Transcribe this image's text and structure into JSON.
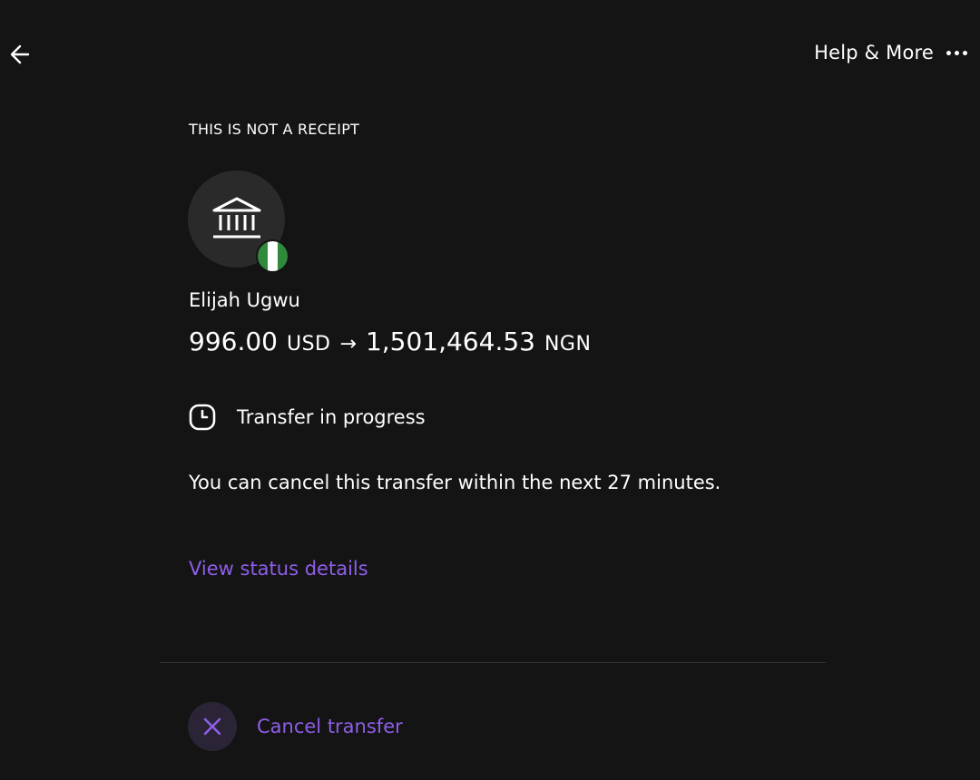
{
  "header": {
    "back_icon": "arrow-left-icon",
    "help_label": "Help & More",
    "more_icon": "more-horizontal-icon"
  },
  "notice": {
    "not_receipt": "THIS IS NOT A RECEIPT"
  },
  "recipient": {
    "avatar_icon": "bank-icon",
    "country_flag": "nigeria-flag",
    "name": "Elijah Ugwu"
  },
  "amount": {
    "send_value": "996.00",
    "send_currency": "USD",
    "arrow": "→",
    "receive_value": "1,501,464.53",
    "receive_currency": "NGN"
  },
  "status": {
    "icon": "clock-icon",
    "text": "Transfer in progress"
  },
  "cancel_notice": "You can cancel this transfer within the next 27 minutes.",
  "links": {
    "view_status": "View status details"
  },
  "actions": {
    "cancel_icon": "close-icon",
    "cancel_label": "Cancel transfer"
  },
  "colors": {
    "background": "#141414",
    "accent": "#8f5ee8",
    "flag_green": "#2f8a3c"
  }
}
